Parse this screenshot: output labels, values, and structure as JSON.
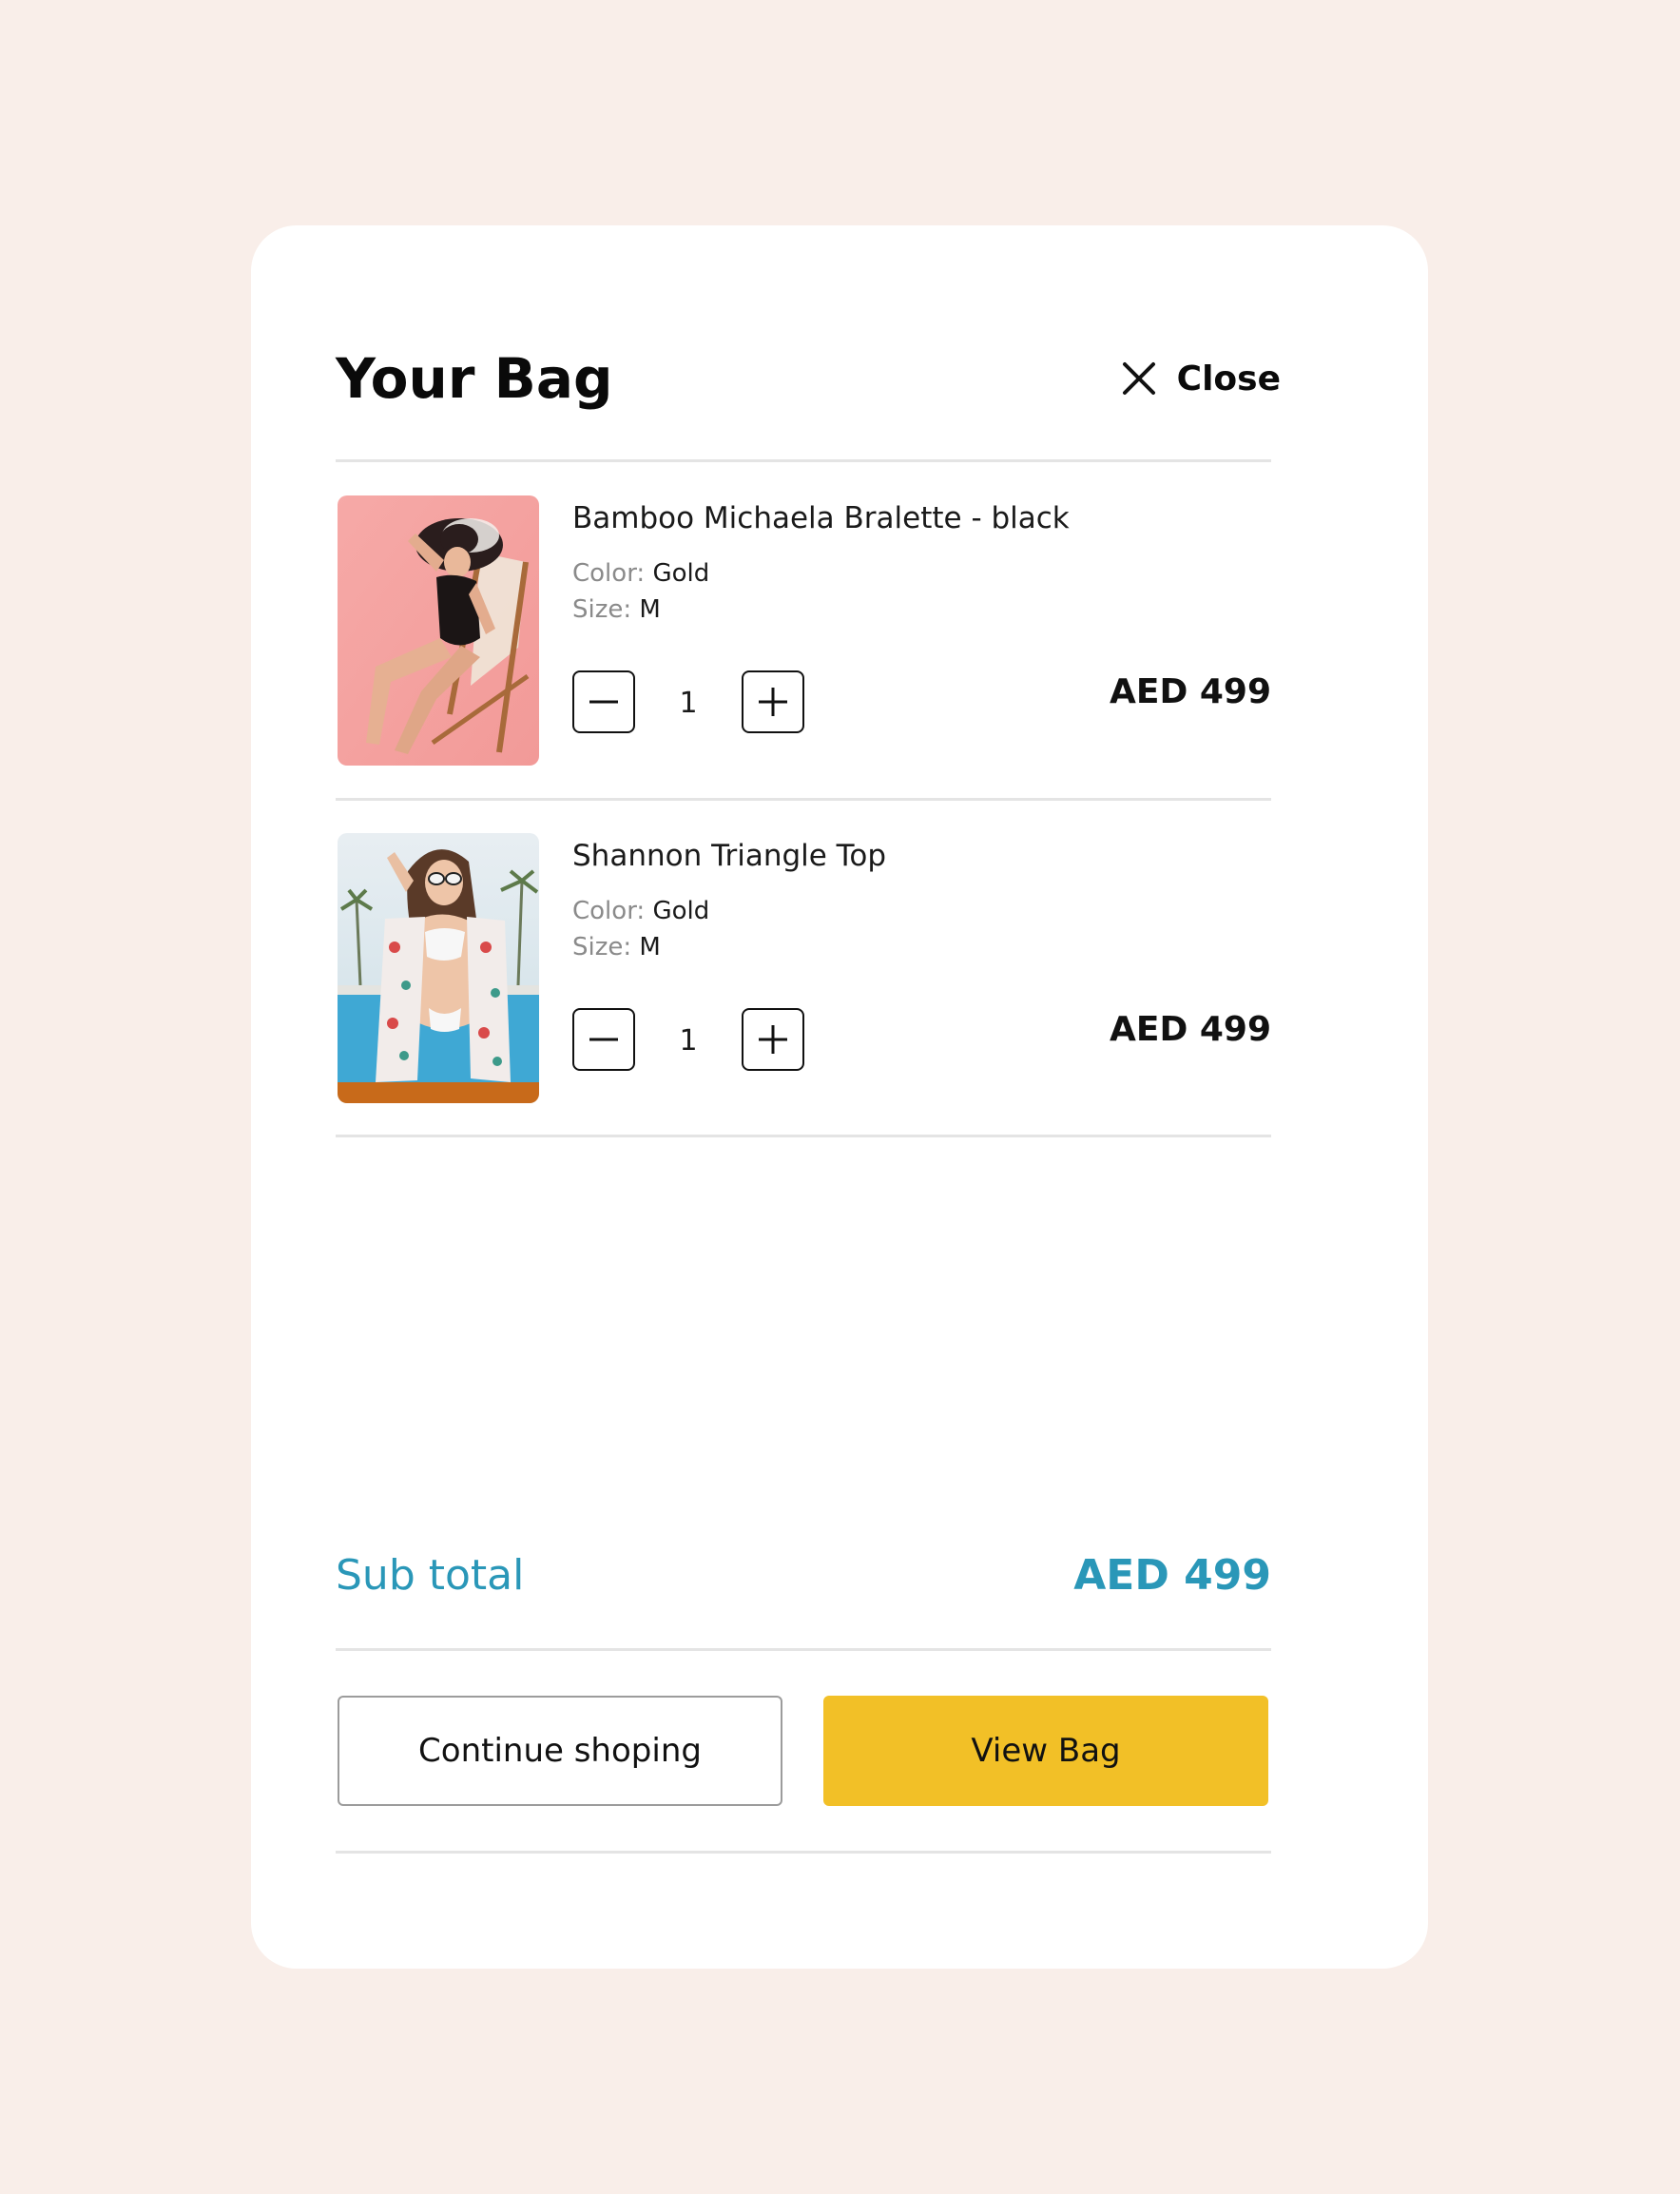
{
  "header": {
    "title": "Your Bag",
    "close_label": "Close",
    "close_icon": "close-icon"
  },
  "items": [
    {
      "name": "Bamboo Michaela Bralette - black",
      "color_label": "Color:",
      "color_value": "Gold",
      "size_label": "Size:",
      "size_value": "M",
      "quantity": "1",
      "price": "AED 499",
      "image": "woman in black swimsuit sitting on deck chair, pink background"
    },
    {
      "name": "Shannon Triangle Top",
      "color_label": "Color:",
      "color_value": "Gold",
      "size_label": "Size:",
      "size_value": "M",
      "quantity": "1",
      "price": "AED 499",
      "image": "woman in white bikini with floral kimono by pool"
    }
  ],
  "summary": {
    "subtotal_label": "Sub total",
    "subtotal_value": "AED 499"
  },
  "actions": {
    "continue_label": "Continue shoping",
    "view_bag_label": "View Bag"
  },
  "colors": {
    "page_background": "#f9eee9",
    "card_background": "#ffffff",
    "accent": "#2a97b8",
    "primary_button": "#f2c027",
    "divider": "#e4e4e4"
  }
}
